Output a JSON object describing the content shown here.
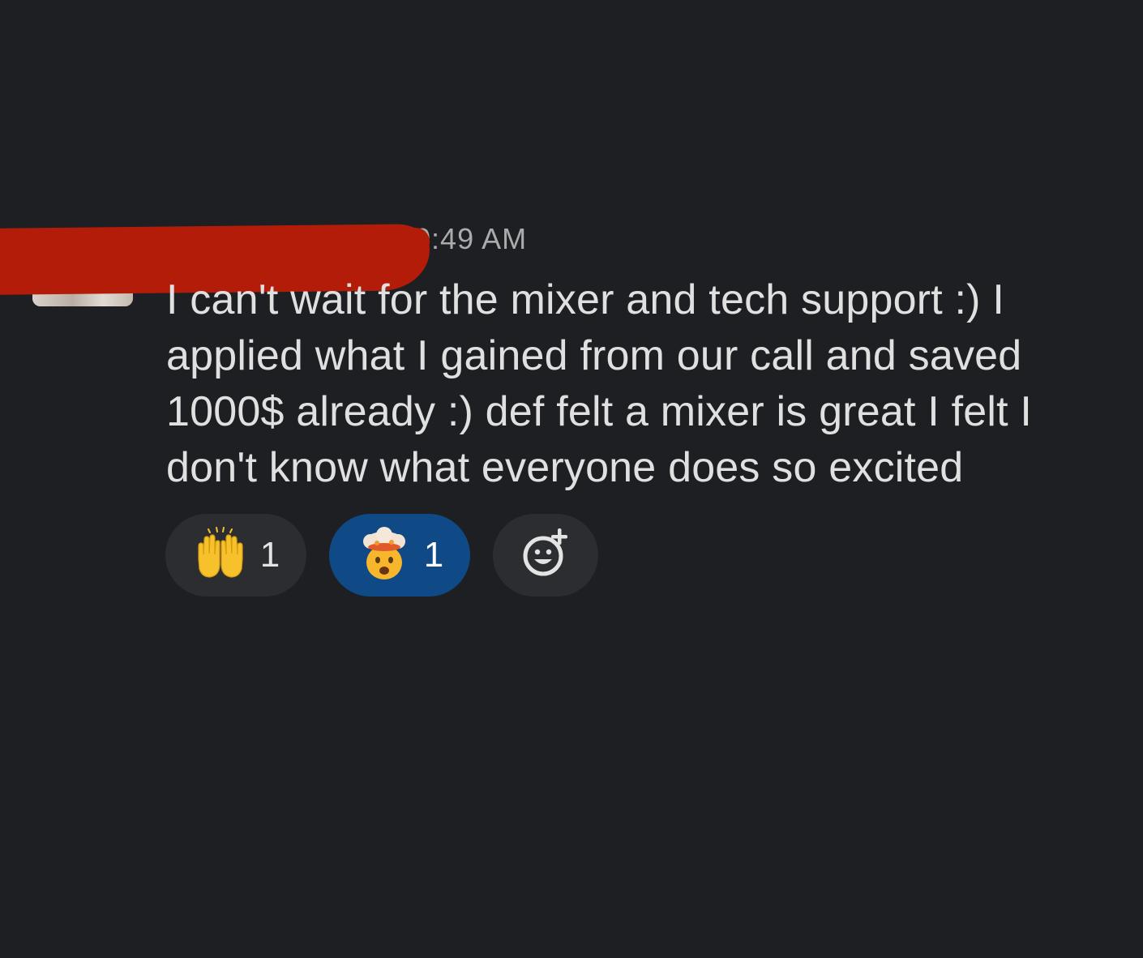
{
  "message": {
    "timestamp": "10:49 AM",
    "text": "I can't wait for the mixer and tech support :) I applied what I gained from our call and saved 1000$ already :) def felt a mixer is great I felt I don't know what everyone does so excited"
  },
  "reactions": [
    {
      "icon": "raising-hands-emoji-icon",
      "count": "1",
      "selected": false
    },
    {
      "icon": "exploding-head-emoji-icon",
      "count": "1",
      "selected": true
    }
  ],
  "add_reaction": {
    "icon": "add-reaction-icon"
  },
  "colors": {
    "background": "#1e1f22",
    "pill": "#2c2d31",
    "pill_selected": "#0f4a86",
    "redaction": "#b31c09"
  }
}
